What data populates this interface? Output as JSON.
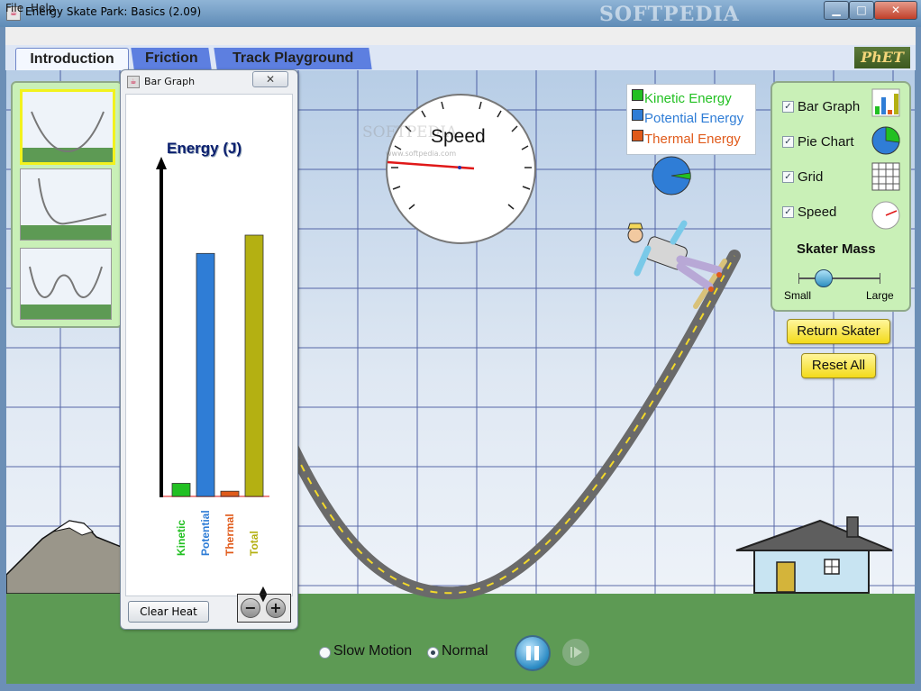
{
  "window": {
    "title": "Energy Skate Park: Basics (2.09)",
    "watermark": "SOFTPEDIA"
  },
  "menu": {
    "file": "File",
    "help": "Help"
  },
  "tabs": [
    "Introduction",
    "Friction",
    "Track Playground"
  ],
  "logo": "PhET",
  "bar_graph": {
    "title": "Bar Graph",
    "chart_title": "Energy (J)",
    "bars": [
      {
        "label": "Kinetic",
        "value": 0.05,
        "color": "#22c022"
      },
      {
        "label": "Potential",
        "value": 0.93,
        "color": "#2f7dd6"
      },
      {
        "label": "Thermal",
        "value": 0.02,
        "color": "#e05a1a"
      },
      {
        "label": "Total",
        "value": 1.0,
        "color": "#b4b012"
      }
    ],
    "clear_heat": "Clear Heat",
    "zoom_out": "−",
    "zoom_in": "+"
  },
  "speedometer": {
    "label": "Speed",
    "watermark": "SOFTPEDIA",
    "watermark_url": "www.softpedia.com"
  },
  "legend": [
    {
      "label": "Kinetic Energy",
      "color": "#22c022"
    },
    {
      "label": "Potential Energy",
      "color": "#2f7dd6"
    },
    {
      "label": "Thermal Energy",
      "color": "#e05a1a"
    }
  ],
  "controls": {
    "bar_graph": "Bar Graph",
    "pie_chart": "Pie Chart",
    "grid": "Grid",
    "speed": "Speed",
    "mass_title": "Skater Mass",
    "mass_small": "Small",
    "mass_large": "Large",
    "mass_level": 0.3
  },
  "buttons": {
    "return_skater": "Return Skater",
    "reset_all": "Reset All"
  },
  "playback": {
    "slow_motion": "Slow Motion",
    "normal": "Normal",
    "selected": "Normal"
  }
}
